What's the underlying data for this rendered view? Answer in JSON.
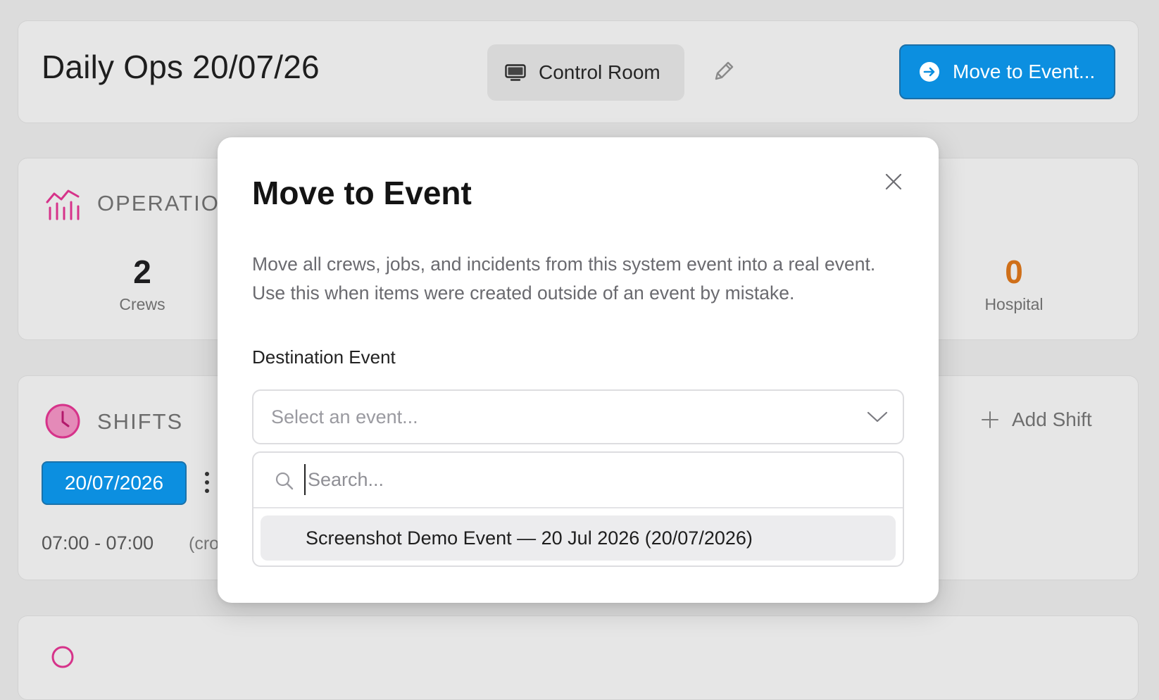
{
  "header": {
    "title": "Daily Ops 20/07/26",
    "control_room_label": "Control Room",
    "move_event_label": "Move to Event..."
  },
  "operations": {
    "title": "OPERATIO",
    "crews": {
      "value": "2",
      "label": "Crews"
    },
    "hospital": {
      "value": "0",
      "label": "Hospital"
    }
  },
  "shifts": {
    "title": "SHIFTS",
    "add_label": "Add Shift",
    "date_chip": "20/07/2026",
    "time_range": "07:00 - 07:00",
    "crews_note": "(cro"
  },
  "modal": {
    "title": "Move to Event",
    "description": "Move all crews, jobs, and incidents from this system event into a real event. Use this when items were created outside of an event by mistake.",
    "field_label": "Destination Event",
    "select_placeholder": "Select an event...",
    "search_placeholder": "Search...",
    "options": [
      "Screenshot Demo Event — 20 Jul 2026 (20/07/2026)"
    ]
  },
  "colors": {
    "accent_blue": "#0c8fe0",
    "brand_pink": "#d6338a",
    "hospital_orange": "#cf6f19",
    "page_bg": "#dcdcdc",
    "card_bg": "#e6e6e6"
  },
  "icons": {
    "header_control": "monitor-icon",
    "header_edit": "pencil-icon",
    "header_move": "arrow-right-circle-icon",
    "operations": "chart-icon",
    "shifts": "clock-icon",
    "modal_close": "close-icon",
    "select": "chevron-down-icon",
    "search": "search-icon",
    "add": "plus-icon",
    "more": "kebab-icon"
  }
}
